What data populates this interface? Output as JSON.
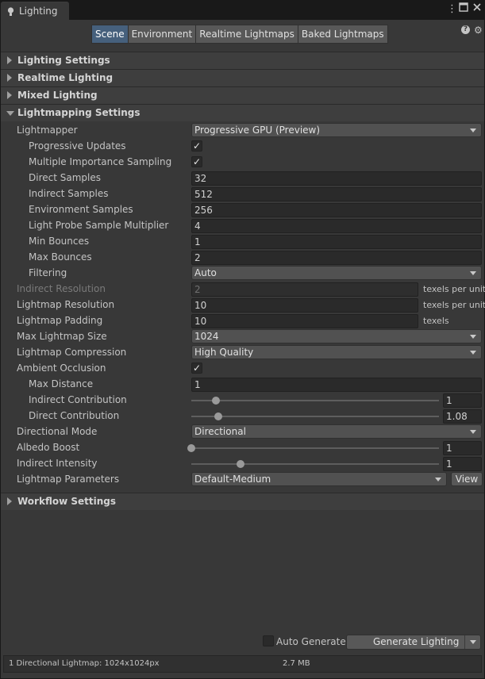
{
  "window": {
    "tab_title": "Lighting",
    "menu_icon": "kebab-icon",
    "maximize_icon": "maximize-icon",
    "close_icon": "close-icon"
  },
  "toolbar": {
    "tabs": [
      "Scene",
      "Environment",
      "Realtime Lightmaps",
      "Baked Lightmaps"
    ],
    "active_tab": "Scene"
  },
  "sections": {
    "lighting_settings": "Lighting Settings",
    "realtime_lighting": "Realtime Lighting",
    "mixed_lighting": "Mixed Lighting",
    "lightmapping_settings": "Lightmapping Settings",
    "workflow_settings": "Workflow Settings"
  },
  "lightmapping": {
    "lightmapper": {
      "label": "Lightmapper",
      "value": "Progressive GPU (Preview)"
    },
    "progressive_updates": {
      "label": "Progressive Updates",
      "checked": "✓"
    },
    "mis": {
      "label": "Multiple Importance Sampling",
      "checked": "✓"
    },
    "direct_samples": {
      "label": "Direct Samples",
      "value": "32"
    },
    "indirect_samples": {
      "label": "Indirect Samples",
      "value": "512"
    },
    "environment_samples": {
      "label": "Environment Samples",
      "value": "256"
    },
    "light_probe_mult": {
      "label": "Light Probe Sample Multiplier",
      "value": "4"
    },
    "min_bounces": {
      "label": "Min Bounces",
      "value": "1"
    },
    "max_bounces": {
      "label": "Max Bounces",
      "value": "2"
    },
    "filtering": {
      "label": "Filtering",
      "value": "Auto"
    },
    "indirect_resolution": {
      "label": "Indirect Resolution",
      "value": "2",
      "unit": "texels per unit"
    },
    "lightmap_resolution": {
      "label": "Lightmap Resolution",
      "value": "10",
      "unit": "texels per unit"
    },
    "lightmap_padding": {
      "label": "Lightmap Padding",
      "value": "10",
      "unit": "texels"
    },
    "max_lightmap_size": {
      "label": "Max Lightmap Size",
      "value": "1024"
    },
    "lightmap_compression": {
      "label": "Lightmap Compression",
      "value": "High Quality"
    },
    "ambient_occlusion": {
      "label": "Ambient Occlusion",
      "checked": "✓"
    },
    "max_distance": {
      "label": "Max Distance",
      "value": "1"
    },
    "indirect_contribution": {
      "label": "Indirect Contribution",
      "value": "1",
      "min": 0,
      "max": 10
    },
    "direct_contribution": {
      "label": "Direct Contribution",
      "value": "1.08",
      "min": 0,
      "max": 10
    },
    "directional_mode": {
      "label": "Directional Mode",
      "value": "Directional"
    },
    "albedo_boost": {
      "label": "Albedo Boost",
      "value": "1",
      "min": 1,
      "max": 10
    },
    "indirect_intensity": {
      "label": "Indirect Intensity",
      "value": "1",
      "min": 0,
      "max": 5
    },
    "lightmap_parameters": {
      "label": "Lightmap Parameters",
      "value": "Default-Medium",
      "button": "View"
    }
  },
  "footer": {
    "auto_generate": "Auto Generate",
    "generate_button": "Generate Lighting",
    "status_left": "1 Directional Lightmap: 1024x1024px",
    "status_right": "2.7 MB"
  },
  "icons": {
    "help": "help-icon",
    "settings": "gear-icon",
    "tab": "lightbulb-icon"
  }
}
